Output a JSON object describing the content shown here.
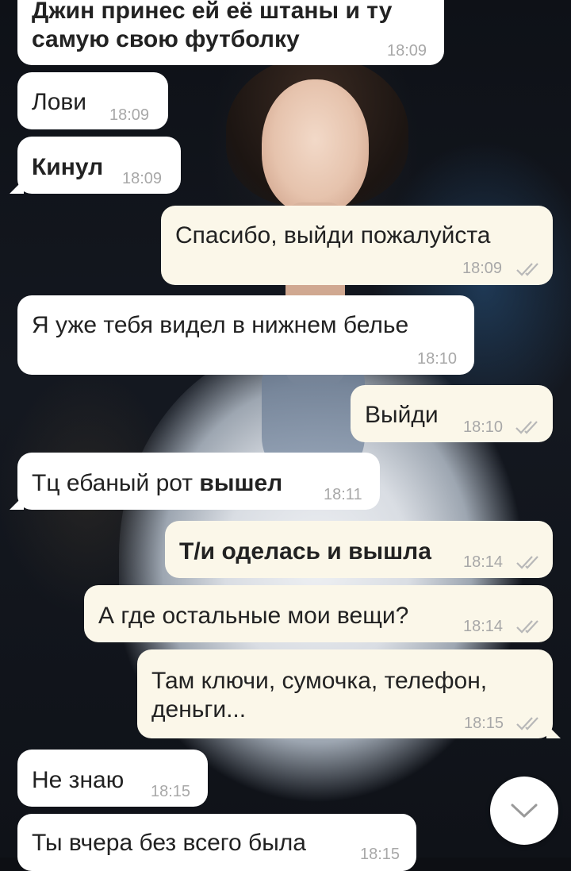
{
  "messages": [
    {
      "side": "in",
      "lines": [
        "Джин принес ей её штаны и ту",
        "самую свою футболку"
      ],
      "bold": true,
      "time": "18:09"
    },
    {
      "side": "in",
      "text": "Лови",
      "time": "18:09"
    },
    {
      "side": "in",
      "text": "Кинул",
      "bold": true,
      "time": "18:09"
    },
    {
      "side": "out",
      "text": "Спасибо, выйди пожалуйста",
      "time": "18:09"
    },
    {
      "side": "in",
      "text": "Я уже тебя видел в нижнем белье",
      "time": "18:10"
    },
    {
      "side": "out",
      "text": "Выйди",
      "time": "18:10"
    },
    {
      "side": "in",
      "text_plain": "Тц ебаный рот ",
      "text_bold": "вышел",
      "time": "18:11"
    },
    {
      "side": "out",
      "text": "Т/и оделась и вышла",
      "bold": true,
      "time": "18:14"
    },
    {
      "side": "out",
      "text": "А где остальные мои вещи?",
      "time": "18:14"
    },
    {
      "side": "out",
      "lines": [
        "Там ключи, сумочка, телефон,",
        "деньги..."
      ],
      "time": "18:15"
    },
    {
      "side": "in",
      "text": "Не знаю",
      "time": "18:15"
    },
    {
      "side": "in",
      "text": "Ты вчера без всего была",
      "time": "18:15"
    }
  ],
  "icons": {
    "read_receipt": "double-check-icon",
    "scroll_down": "chevron-down-icon"
  },
  "colors": {
    "incoming_bubble": "#ffffff",
    "outgoing_bubble": "#fbf7e9",
    "check": "#b8b8b8",
    "time": "#a8a8a8"
  }
}
